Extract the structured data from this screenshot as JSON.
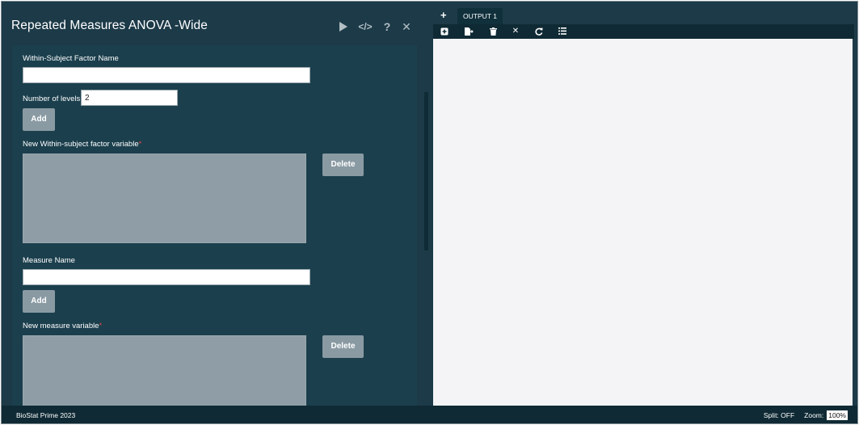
{
  "dialog": {
    "title": "Repeated Measures ANOVA -Wide",
    "header_icons": [
      "run-icon",
      "code-icon",
      "help-icon",
      "close-icon"
    ],
    "within_subject_factor_label": "Within-Subject Factor Name",
    "within_subject_factor_value": "",
    "levels_label": "Number of levels",
    "levels_value": "2",
    "add_label": "Add",
    "new_within_variable_label": "New Within-subject factor variable",
    "required_mark": "*",
    "delete_label": "Delete",
    "measure_name_label": "Measure Name",
    "measure_name_value": "",
    "new_measure_variable_label": "New measure variable"
  },
  "output": {
    "add_tab_symbol": "+",
    "tab_label": "OUTPUT 1",
    "toolbar_icons": [
      "add-box-icon",
      "export-icon",
      "trash-icon",
      "close-icon",
      "refresh-icon",
      "list-icon"
    ]
  },
  "statusbar": {
    "app_name": "BioStat Prime 2023",
    "split_label": "Split: OFF",
    "zoom_label": "Zoom:",
    "zoom_value": "100%"
  },
  "colors": {
    "background": "#1c3a48",
    "panel": "#1b3f4d",
    "button": "#8a9aa3",
    "output_canvas": "#f4f4f6",
    "required": "#e04848"
  }
}
